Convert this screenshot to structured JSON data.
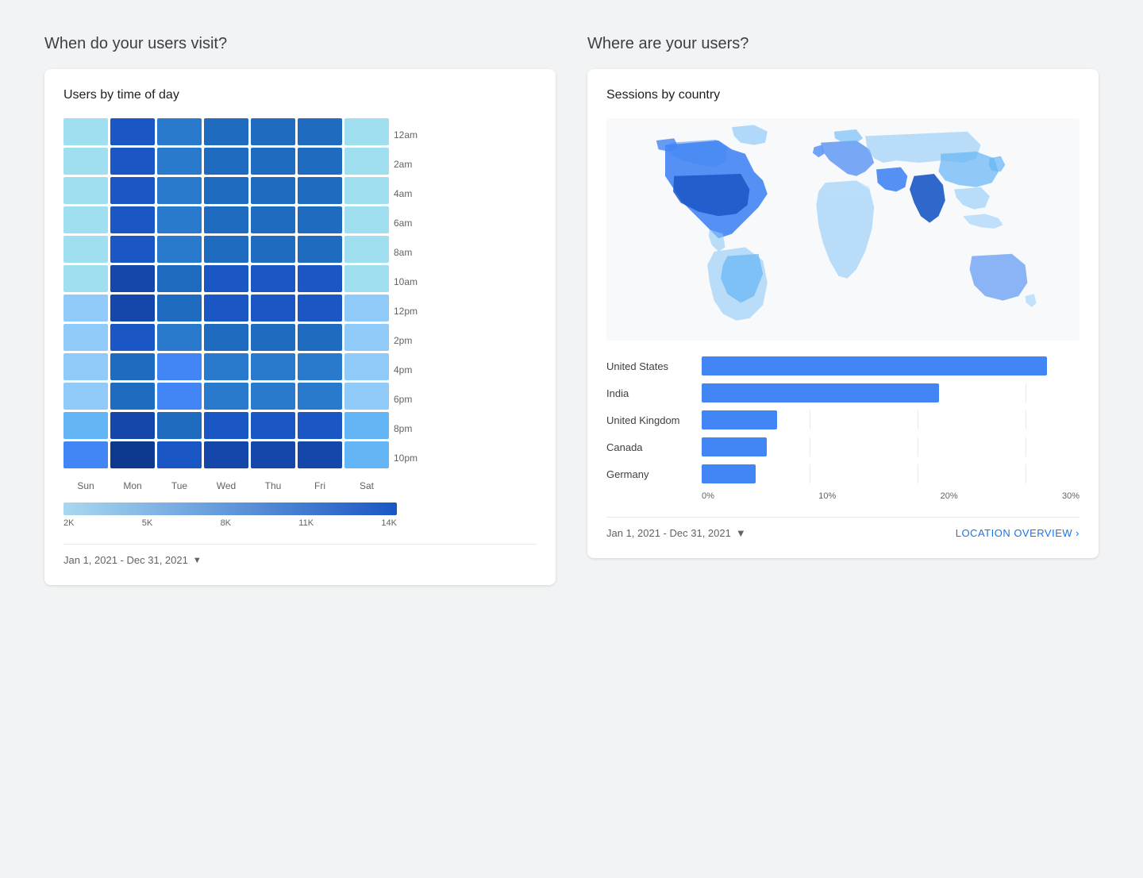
{
  "left_section_title": "When do your users visit?",
  "right_section_title": "Where are your users?",
  "heatmap_card": {
    "title": "Users by time of day",
    "time_labels": [
      "12am",
      "2am",
      "4am",
      "6am",
      "8am",
      "10am",
      "12pm",
      "2pm",
      "4pm",
      "6pm",
      "8pm",
      "10pm"
    ],
    "day_labels": [
      "Sun",
      "Mon",
      "Tue",
      "Wed",
      "Thu",
      "Fri",
      "Sat"
    ],
    "legend_values": [
      "2K",
      "5K",
      "8K",
      "11K",
      "14K"
    ],
    "date_range": "Jan 1, 2021 - Dec 31, 2021",
    "cells": [
      [
        2,
        8,
        6,
        7,
        7,
        7,
        2
      ],
      [
        2,
        8,
        6,
        7,
        7,
        7,
        2
      ],
      [
        2,
        8,
        6,
        7,
        7,
        7,
        2
      ],
      [
        2,
        8,
        6,
        7,
        7,
        7,
        2
      ],
      [
        2,
        8,
        6,
        7,
        7,
        7,
        2
      ],
      [
        2,
        9,
        7,
        8,
        8,
        8,
        2
      ],
      [
        3,
        9,
        7,
        8,
        8,
        8,
        3
      ],
      [
        3,
        8,
        6,
        7,
        7,
        7,
        3
      ],
      [
        3,
        7,
        5,
        6,
        6,
        6,
        3
      ],
      [
        3,
        7,
        5,
        6,
        6,
        6,
        3
      ],
      [
        4,
        9,
        7,
        8,
        8,
        8,
        4
      ],
      [
        5,
        10,
        8,
        9,
        9,
        9,
        4
      ]
    ]
  },
  "map_card": {
    "title": "Sessions by country",
    "date_range": "Jan 1, 2021 - Dec 31, 2021",
    "overview_link": "LOCATION OVERVIEW",
    "bars": [
      {
        "label": "United States",
        "pct": 32
      },
      {
        "label": "India",
        "pct": 22
      },
      {
        "label": "United Kingdom",
        "pct": 7
      },
      {
        "label": "Canada",
        "pct": 6
      },
      {
        "label": "Germany",
        "pct": 5
      }
    ],
    "axis_labels": [
      "0%",
      "10%",
      "20%",
      "30%"
    ]
  }
}
